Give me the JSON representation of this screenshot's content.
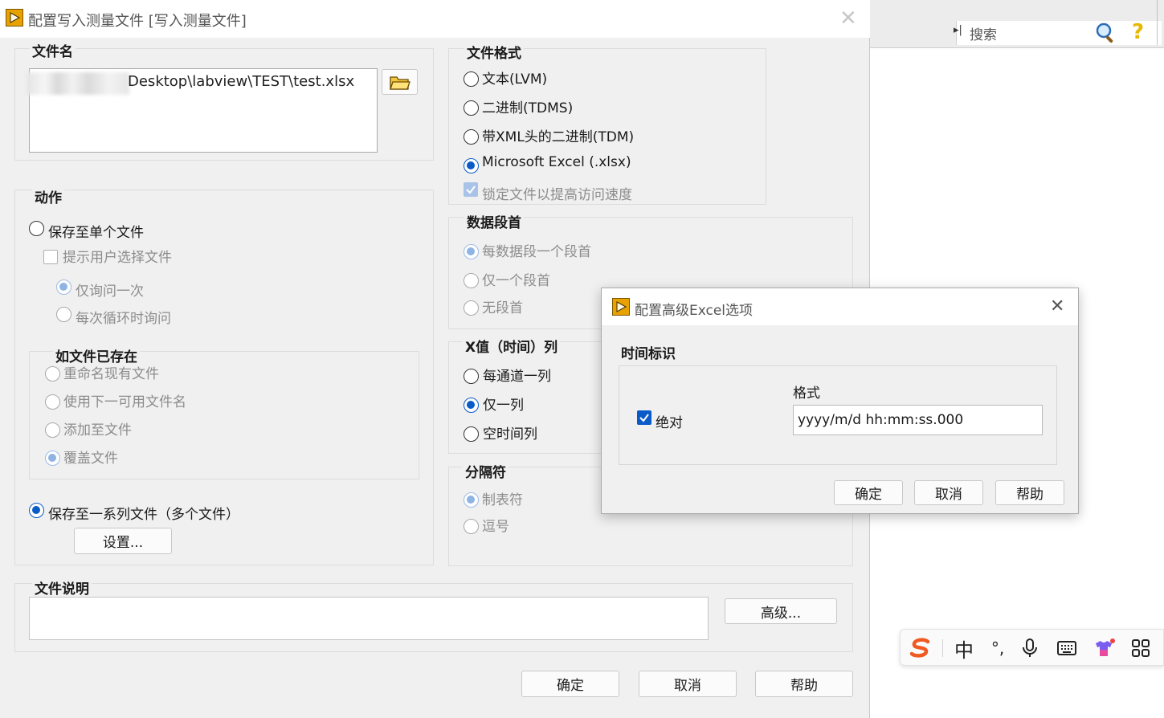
{
  "background_window": {
    "search_placeholder": "搜索",
    "search_arrow": "▸|",
    "help_glyph": "?"
  },
  "main_dialog": {
    "title": "配置写入测量文件 [写入测量文件]",
    "filename": {
      "group_title": "文件名",
      "path_value": "Desktop\\labview\\TEST\\test.xlsx",
      "path_prefix_blurred": "C:\\Users\\user\\D",
      "path_first_char": "D"
    },
    "action": {
      "group_title": "动作",
      "save_single": "保存至单个文件",
      "prompt_user": "提示用户选择文件",
      "ask_once": "仅询问一次",
      "ask_each_loop": "每次循环时询问",
      "if_exists": {
        "group_title": "如文件已存在",
        "rename_existing": "重命名现有文件",
        "use_next_name": "使用下一可用文件名",
        "append": "添加至文件",
        "overwrite": "覆盖文件"
      },
      "save_series": "保存至一系列文件（多个文件）",
      "settings_button": "设置..."
    },
    "file_format": {
      "group_title": "文件格式",
      "text_lvm": "文本(LVM)",
      "binary_tdms": "二进制(TDMS)",
      "binary_xml_tdm": "带XML头的二进制(TDM)",
      "excel_xlsx": "Microsoft Excel (.xlsx)",
      "lock_file": "锁定文件以提高访问速度"
    },
    "segment_header": {
      "group_title": "数据段首",
      "one_per_segment": "每数据段一个段首",
      "only_one": "仅一个段首",
      "none": "无段首"
    },
    "x_column": {
      "group_title": "X值（时间）列",
      "per_channel": "每通道一列",
      "only_one": "仅一列",
      "empty_time": "空时间列"
    },
    "delimiter": {
      "group_title": "分隔符",
      "tab": "制表符",
      "comma": "逗号"
    },
    "file_description": {
      "group_title": "文件说明",
      "value": "",
      "advanced_button": "高级..."
    },
    "buttons": {
      "ok": "确定",
      "cancel": "取消",
      "help": "帮助"
    }
  },
  "excel_dialog": {
    "title": "配置高级Excel选项",
    "group_title": "时间标识",
    "absolute_label": "绝对",
    "format_label": "格式",
    "format_value": "yyyy/m/d hh:mm:ss.000",
    "buttons": {
      "ok": "确定",
      "cancel": "取消",
      "help": "帮助"
    }
  },
  "ime_bar": {
    "mode_label": "中",
    "punct_label": "°,"
  },
  "colors": {
    "accent": "#0a5bc8",
    "dialog_bg": "#f0f0f0",
    "disabled_text": "#8c8c8c",
    "labview_icon": "#e8a200",
    "sogou_orange": "#f05a22"
  }
}
